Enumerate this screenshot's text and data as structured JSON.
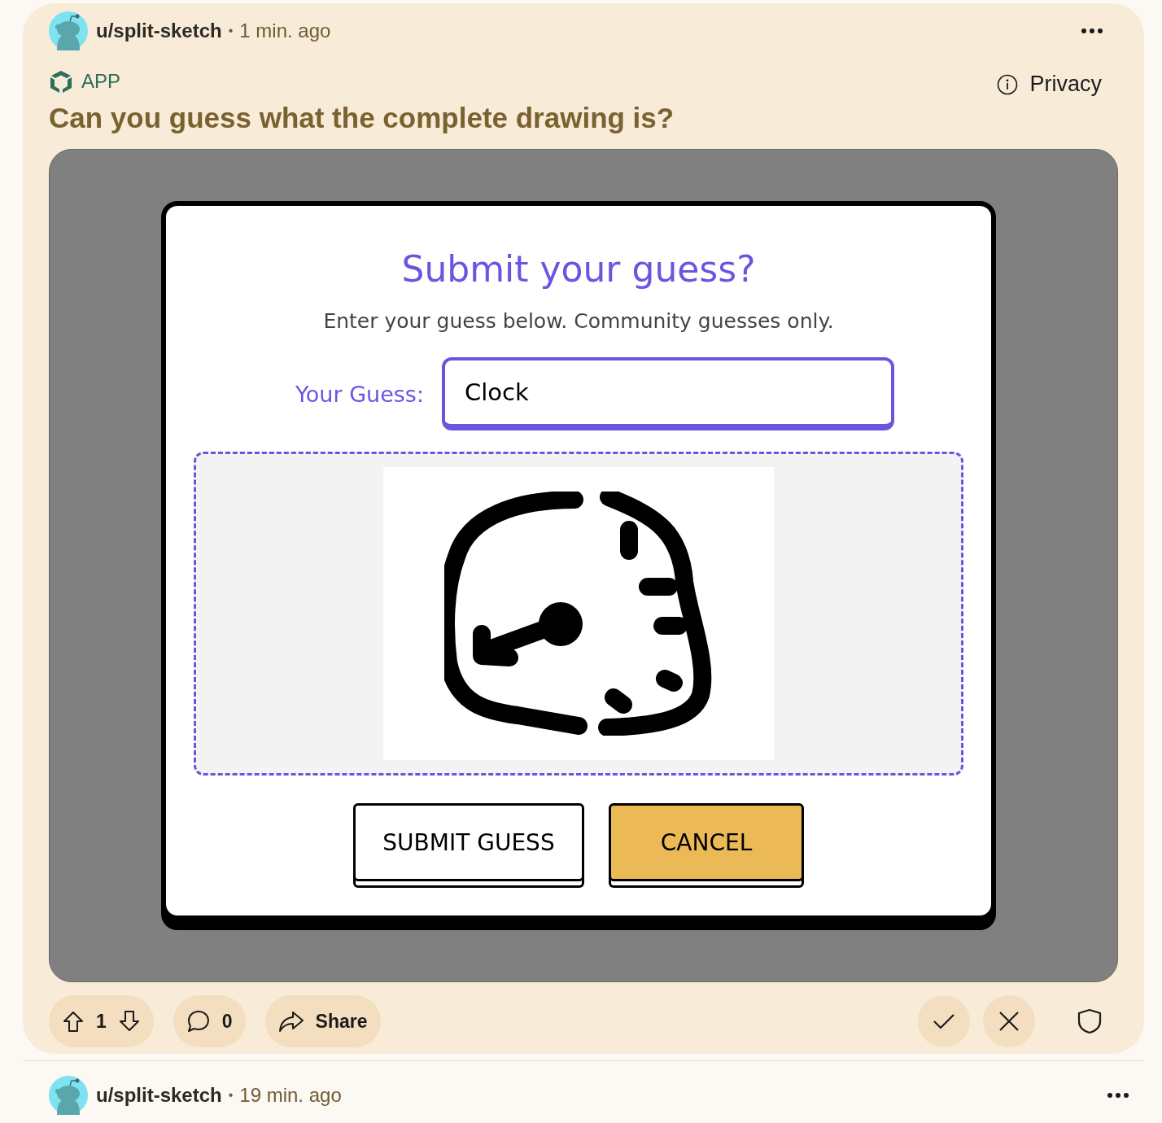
{
  "post": {
    "author": "u/split-sketch",
    "separator": "•",
    "time": "1 min. ago",
    "app_badge": "APP",
    "privacy": "Privacy",
    "title": "Can you guess what the complete drawing is?"
  },
  "embed": {
    "dialog": {
      "title": "Submit your guess?",
      "subtitle": "Enter your guess below. Community guesses only.",
      "field_label": "Your Guess:",
      "field_value": "Clock",
      "buttons": [
        {
          "label": "SUBMIT GUESS",
          "kind": "secondary"
        },
        {
          "label": "CANCEL",
          "kind": "primary"
        }
      ]
    }
  },
  "actions": {
    "votes": "1",
    "comments": "0",
    "share": "Share"
  },
  "next_post": {
    "author": "u/split-sketch",
    "separator": "•",
    "time": "19 min. ago"
  }
}
